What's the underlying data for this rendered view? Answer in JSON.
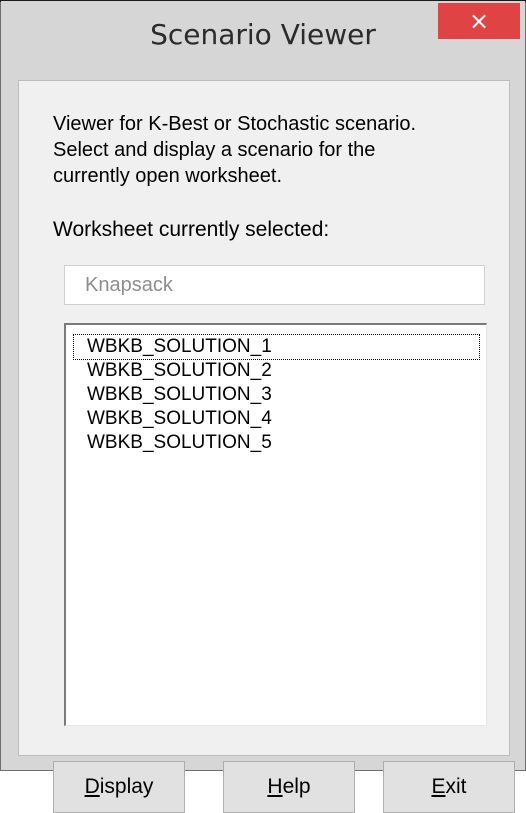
{
  "window": {
    "title": "Scenario Viewer",
    "close_symbol": "×"
  },
  "panel": {
    "description": "Viewer for K-Best or Stochastic scenario.\nSelect and display a scenario for the\ncurrently open worksheet.",
    "worksheet_label": "Worksheet currently selected:",
    "worksheet_value": "Knapsack"
  },
  "scenario_list": {
    "items": [
      "WBKB_SOLUTION_1",
      "WBKB_SOLUTION_2",
      "WBKB_SOLUTION_3",
      "WBKB_SOLUTION_4",
      "WBKB_SOLUTION_5"
    ],
    "selected_index": 0
  },
  "buttons": {
    "display": {
      "accel": "D",
      "rest": "isplay"
    },
    "help": {
      "accel": "H",
      "rest": "elp"
    },
    "exit": {
      "accel": "E",
      "rest": "xit"
    }
  },
  "colors": {
    "close_button": "#e04343",
    "chrome": "#d6d6d6",
    "dialog_bg": "#f0f0f0"
  },
  "icons": {
    "close": "close-icon"
  }
}
